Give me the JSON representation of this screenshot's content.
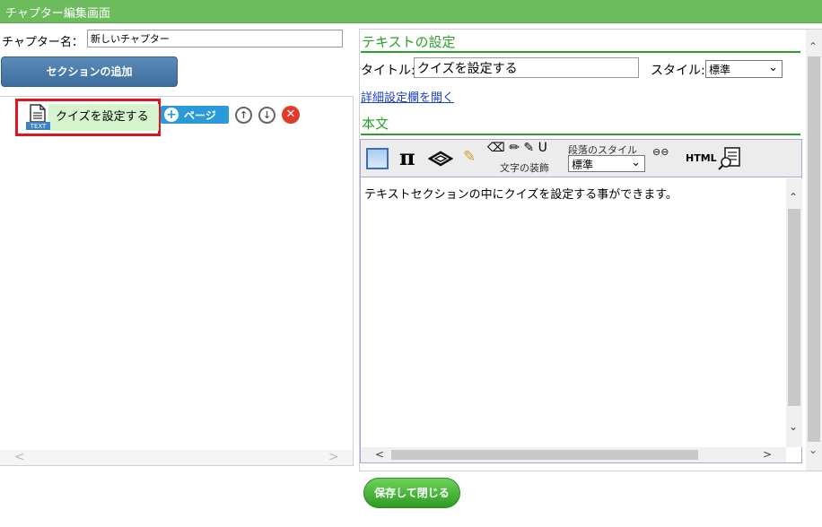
{
  "window": {
    "title": "チャプター編集画面"
  },
  "chapter": {
    "name_label": "チャプター名：",
    "name_value": "新しいチャプター"
  },
  "left": {
    "add_section_label": "セクションの追加",
    "section_items": [
      {
        "label": "クイズを設定する",
        "icon_badge": "TEXT"
      }
    ],
    "page_button_label": "ページ",
    "hscroll": {
      "left": "<",
      "right": ">"
    }
  },
  "text_settings": {
    "heading": "テキストの設定",
    "title_label": "タイトル:",
    "title_value": "クイズを設定する",
    "style_label": "スタイル:",
    "style_value": "標準",
    "detail_link": "詳細設定欄を開く"
  },
  "body_section": {
    "heading": "本文",
    "toolbar": {
      "pi": "π",
      "deco_icons": "⌫ ✏ ✎ U",
      "deco_label": "文字の装飾",
      "para_label": "段落のスタイル",
      "para_value": "標準",
      "link": "⊖⊖",
      "html": "HTML"
    },
    "content": "テキストセクションの中にクイズを設定する事ができます。"
  },
  "save_button_label": "保存して閉じる",
  "colors": {
    "titlebar": "#6cbc5e",
    "accent_green": "#2aa02a",
    "highlight_red": "#e0141e",
    "blue_button": "#3d6e9d"
  }
}
